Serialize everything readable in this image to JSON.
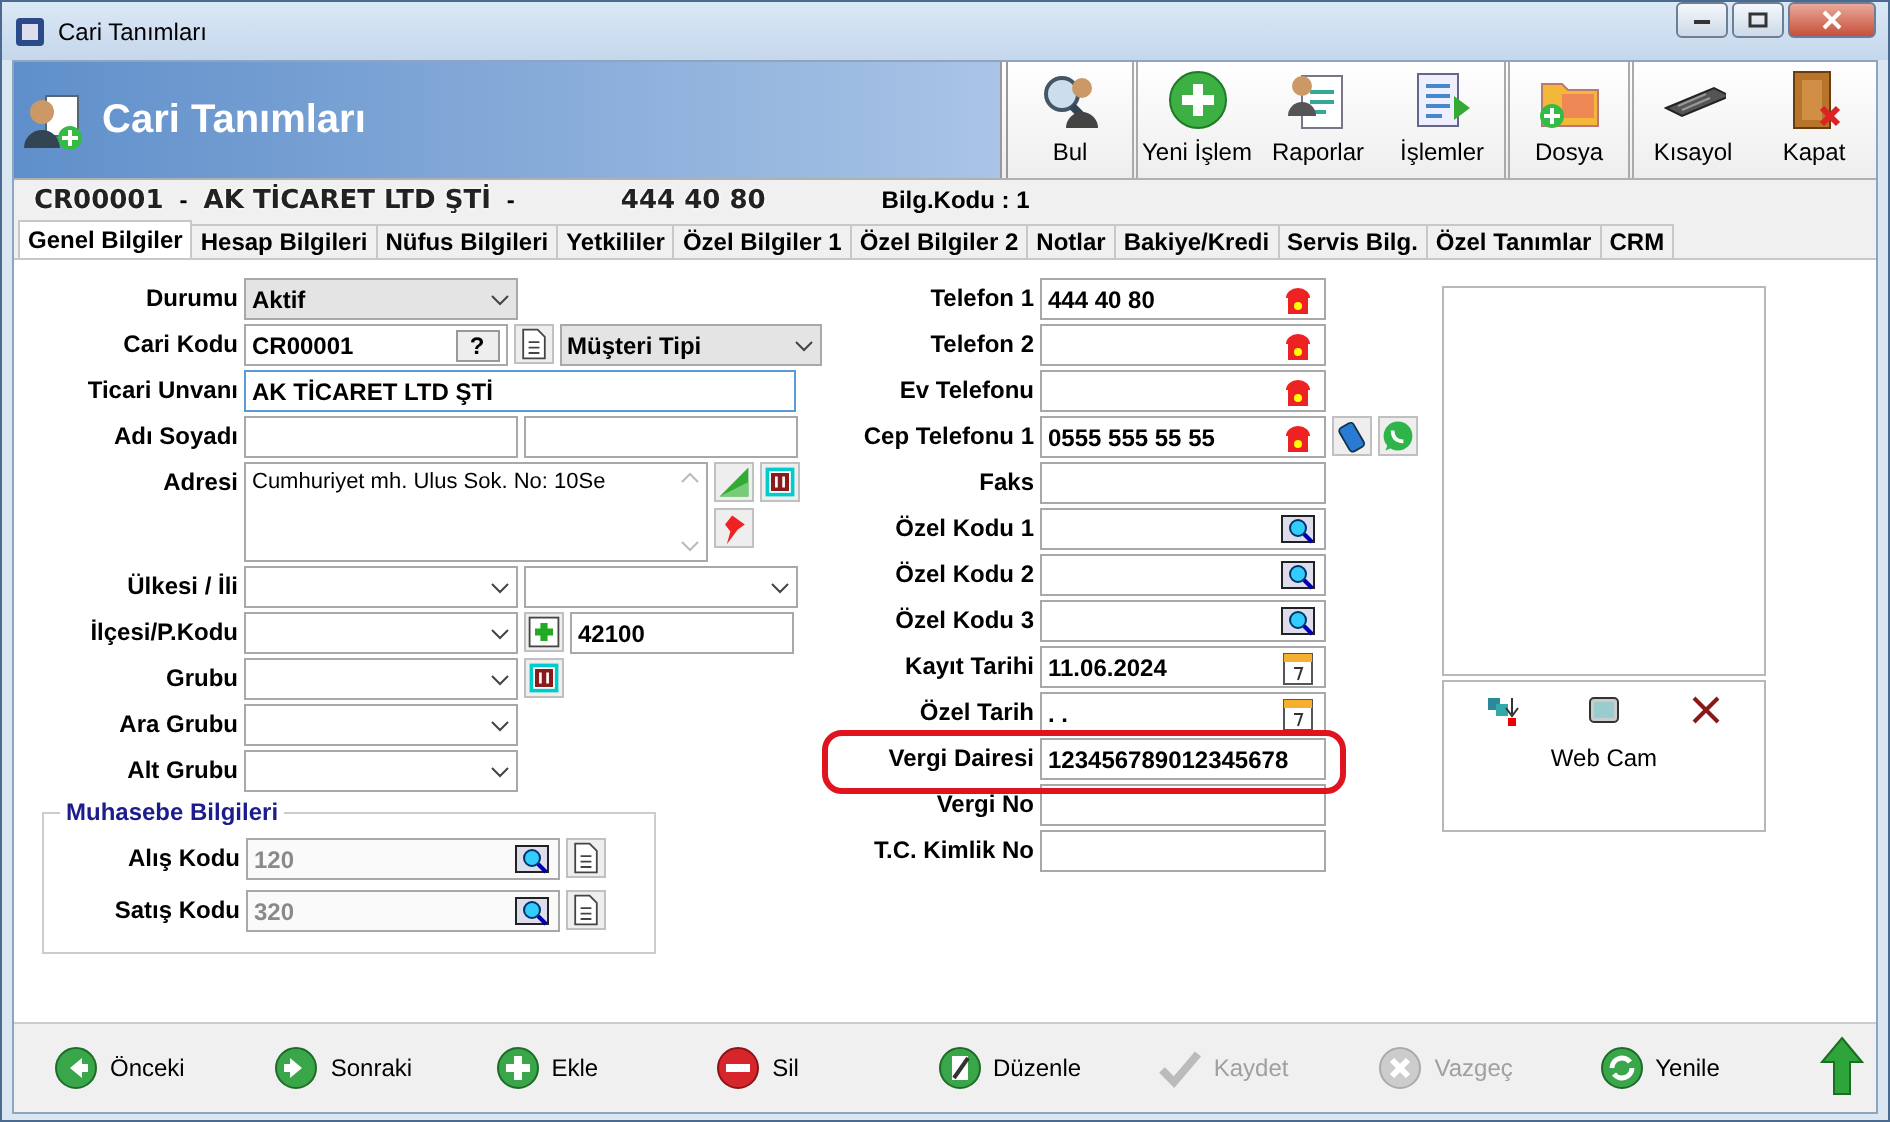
{
  "window": {
    "title": "Cari Tanımları"
  },
  "header": {
    "title": "Cari Tanımları"
  },
  "toolbar": [
    {
      "label": "Bul",
      "kind": "find"
    },
    {
      "label": "Yeni İşlem",
      "kind": "new"
    },
    {
      "label": "Raporlar",
      "kind": "reports"
    },
    {
      "label": "İşlemler",
      "kind": "operations"
    },
    {
      "label": "Dosya",
      "kind": "files"
    },
    {
      "label": "Kısayol",
      "kind": "shortcut"
    },
    {
      "label": "Kapat",
      "kind": "close"
    }
  ],
  "record": {
    "code": "CR00001",
    "separator_1": "-",
    "name": "AK TİCARET LTD ŞTİ",
    "separator_2": "-",
    "phone": "444 40 80",
    "bilg_kodu": "Bilg.Kodu : 1"
  },
  "tabs": [
    {
      "label": "Genel Bilgiler",
      "selected": true
    },
    {
      "label": "Hesap Bilgileri",
      "selected": false
    },
    {
      "label": "Nüfus Bilgileri",
      "selected": false
    },
    {
      "label": "Yetkililer",
      "selected": false
    },
    {
      "label": "Özel Bilgiler 1",
      "selected": false
    },
    {
      "label": "Özel Bilgiler 2",
      "selected": false
    },
    {
      "label": "Notlar",
      "selected": false
    },
    {
      "label": "Bakiye/Kredi",
      "selected": false
    },
    {
      "label": "Servis Bilg.",
      "selected": false
    },
    {
      "label": "Özel Tanımlar",
      "selected": false
    },
    {
      "label": "CRM",
      "selected": false
    }
  ],
  "left_fields": [
    {
      "label": "Durumu",
      "items": [
        {
          "kind": "dropdown",
          "value": "Aktif"
        }
      ]
    },
    {
      "label": "Cari Kodu",
      "items": [
        {
          "kind": "code",
          "value": "CR00001",
          "help": "?"
        },
        {
          "kind": "doc-button"
        },
        {
          "kind": "dropdown",
          "value": "Müşteri Tipi"
        }
      ]
    },
    {
      "label": "Ticari Unvanı",
      "items": [
        {
          "kind": "wide",
          "value": "AK TİCARET LTD ŞTİ",
          "focused": true
        }
      ]
    },
    {
      "label": "Adı Soyadı",
      "items": [
        {
          "kind": "input"
        },
        {
          "kind": "input"
        }
      ]
    },
    {
      "label": "Adresi",
      "items": [
        {
          "kind": "memo",
          "value": "Cumhuriyet mh. Ulus Sok. No: 10Se"
        },
        {
          "kind": "map-buttons"
        }
      ]
    },
    {
      "label": "Ülkesi / İli",
      "items": [
        {
          "kind": "combo"
        },
        {
          "kind": "combo"
        }
      ]
    },
    {
      "label": "İlçesi/P.Kodu",
      "items": [
        {
          "kind": "combo"
        },
        {
          "kind": "add-button"
        },
        {
          "kind": "short",
          "value": "42100"
        }
      ]
    },
    {
      "label": "Grubu",
      "items": [
        {
          "kind": "combo"
        },
        {
          "kind": "pause-button"
        }
      ]
    },
    {
      "label": "Ara Grubu",
      "items": [
        {
          "kind": "combo"
        }
      ]
    },
    {
      "label": "Alt Grubu",
      "items": [
        {
          "kind": "combo"
        }
      ]
    }
  ],
  "muhasebe": {
    "title": "Muhasebe Bilgileri",
    "fields": [
      {
        "label": "Alış Kodu",
        "value": "120",
        "disabled": true
      },
      {
        "label": "Satış Kodu",
        "value": "320",
        "disabled": true
      }
    ]
  },
  "right_fields": [
    {
      "label": "Telefon 1",
      "kind": "phone",
      "value": "444 40 80"
    },
    {
      "label": "Telefon 2",
      "kind": "phone"
    },
    {
      "label": "Ev Telefonu",
      "kind": "phone"
    },
    {
      "label": "Cep Telefonu 1",
      "kind": "mobile",
      "value": "0555 555 55 55"
    },
    {
      "label": "Faks",
      "kind": "input"
    },
    {
      "label": "Özel Kodu 1",
      "kind": "lookup"
    },
    {
      "label": "Özel Kodu 2",
      "kind": "lookup"
    },
    {
      "label": "Özel Kodu 3",
      "kind": "lookup"
    },
    {
      "label": "Kayıt Tarihi",
      "kind": "date",
      "value": "11.06.2024"
    },
    {
      "label": "Özel Tarih",
      "kind": "date",
      "value": " . ."
    },
    {
      "label": "Vergi Dairesi",
      "kind": "input",
      "value": "123456789012345678",
      "highlighted": true
    },
    {
      "label": "Vergi No",
      "kind": "input"
    },
    {
      "label": "T.C. Kimlik No",
      "kind": "input"
    }
  ],
  "webcam": {
    "label": "Web Cam"
  },
  "bottom_buttons": [
    {
      "label": "Önceki",
      "kind": "prev",
      "disabled": false
    },
    {
      "label": "Sonraki",
      "kind": "next",
      "disabled": false
    },
    {
      "label": "Ekle",
      "kind": "add",
      "disabled": false
    },
    {
      "label": "Sil",
      "kind": "delete",
      "disabled": false
    },
    {
      "label": "Düzenle",
      "kind": "edit",
      "disabled": false
    },
    {
      "label": "Kaydet",
      "kind": "save",
      "disabled": true
    },
    {
      "label": "Vazgeç",
      "kind": "cancel",
      "disabled": true
    },
    {
      "label": "Yenile",
      "kind": "refresh",
      "disabled": false
    },
    {
      "kind": "up",
      "disabled": false
    }
  ]
}
